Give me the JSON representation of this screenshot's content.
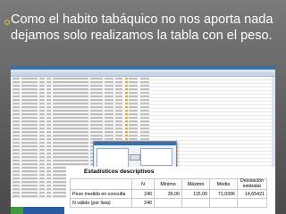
{
  "slide": {
    "title": "Como el habito tabáquico no nos aporta nada dejamos solo realizamos la tabla con el peso."
  },
  "stats_table": {
    "title": "Estadísticos descriptivos",
    "headers": [
      "N",
      "Mínimo",
      "Máximo",
      "Media",
      "Desviación estándar"
    ],
    "rows": [
      {
        "label": "Peso medido en consulta",
        "values": [
          "240",
          "39,00",
          "115,00",
          "71,0396",
          "14,65421"
        ]
      },
      {
        "label": "N válido (por lista)",
        "values": [
          "240",
          "",
          "",
          "",
          ""
        ]
      }
    ]
  },
  "colors": {
    "slide_background": "#6b6b6b",
    "title_text": "#ffffff",
    "spss_title_bar": "#3a6ea5"
  }
}
